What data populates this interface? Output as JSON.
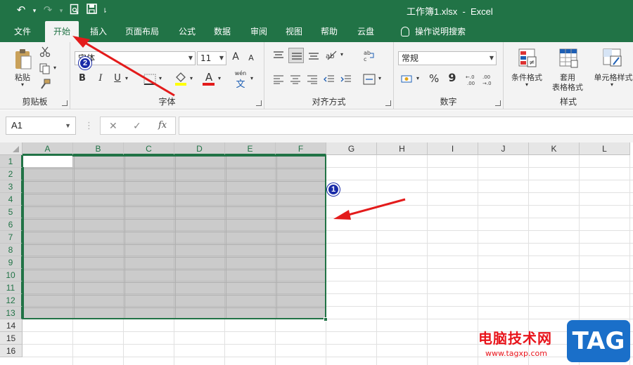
{
  "window": {
    "title": "工作簿1.xlsx  -  Excel"
  },
  "tabs": [
    {
      "label": "文件"
    },
    {
      "label": "开始",
      "active": true
    },
    {
      "label": "插入"
    },
    {
      "label": "页面布局"
    },
    {
      "label": "公式"
    },
    {
      "label": "数据"
    },
    {
      "label": "审阅"
    },
    {
      "label": "视图"
    },
    {
      "label": "帮助"
    },
    {
      "label": "云盘"
    },
    {
      "label": "操作说明搜索"
    }
  ],
  "ribbon": {
    "clipboard": {
      "label": "剪贴板",
      "paste": "粘贴"
    },
    "font": {
      "label": "字体",
      "font_name": "宋体",
      "font_size": "11",
      "bold": "B",
      "italic": "I",
      "underline": "U",
      "grow": "A",
      "shrink": "A",
      "wen": "wén",
      "wen_char": "文",
      "color_a": "A"
    },
    "alignment": {
      "label": "对齐方式"
    },
    "number": {
      "label": "数字",
      "format": "常规",
      "percent": "%",
      "comma": "9"
    },
    "styles": {
      "label": "样式",
      "conditional": "条件格式",
      "table_line1": "套用",
      "table_line2": "表格格式",
      "cell_styles": "单元格样式"
    }
  },
  "formula_bar": {
    "name_box": "A1",
    "cancel": "✕",
    "confirm": "✓",
    "fx": "fx",
    "value": ""
  },
  "sheet": {
    "columns": [
      "A",
      "B",
      "C",
      "D",
      "E",
      "F",
      "G",
      "H",
      "I",
      "J",
      "K",
      "L"
    ],
    "rows": [
      "1",
      "2",
      "3",
      "4",
      "5",
      "6",
      "7",
      "8",
      "9",
      "10",
      "11",
      "12",
      "13",
      "14",
      "15",
      "16"
    ],
    "selection": "A1:F13",
    "active_cell": "A1"
  },
  "annotations": {
    "badge1": "1",
    "badge2": "2",
    "color": "#e31b1b"
  },
  "watermark": {
    "site_name": "电脑技术网",
    "url": "www.tagxp.com",
    "logo": "TAG"
  },
  "colors": {
    "accent": "#217346",
    "ribbon_bg": "#f3f3f3",
    "selection_fill": "#c0c0c0"
  }
}
